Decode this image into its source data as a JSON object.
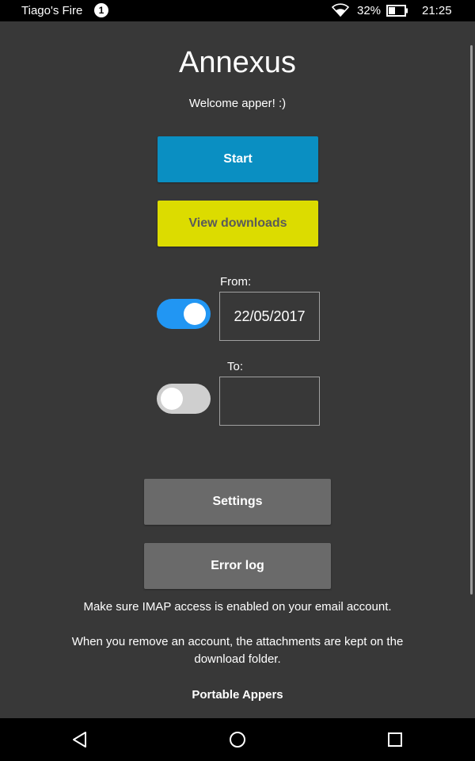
{
  "status_bar": {
    "device_name": "Tiago's Fire",
    "notification_count": "1",
    "battery_percent": "32%",
    "time": "21:25",
    "icons": [
      "wifi-icon",
      "battery-icon"
    ]
  },
  "app": {
    "title": "Annexus",
    "welcome": "Welcome apper! :)"
  },
  "buttons": {
    "start": "Start",
    "view_downloads": "View downloads",
    "settings": "Settings",
    "error_log": "Error log"
  },
  "date_filter": {
    "from_label": "From:",
    "from_value": "22/05/2017",
    "from_enabled": true,
    "to_label": "To:",
    "to_value": "",
    "to_enabled": false
  },
  "info": {
    "imap_note": "Make sure IMAP access is enabled on your email account.",
    "remove_note": "When you remove an account, the attachments are kept on the download folder.",
    "brand": "Portable Appers"
  },
  "nav_bar": {
    "icons": [
      "back-icon",
      "home-icon",
      "recents-icon"
    ]
  },
  "colors": {
    "background": "#383838",
    "start_button": "#0a8fc2",
    "downloads_button": "#dcdc00",
    "toggle_on": "#2196f3",
    "toggle_off": "#cfcfcf",
    "grey_button": "#6a6a6a"
  }
}
